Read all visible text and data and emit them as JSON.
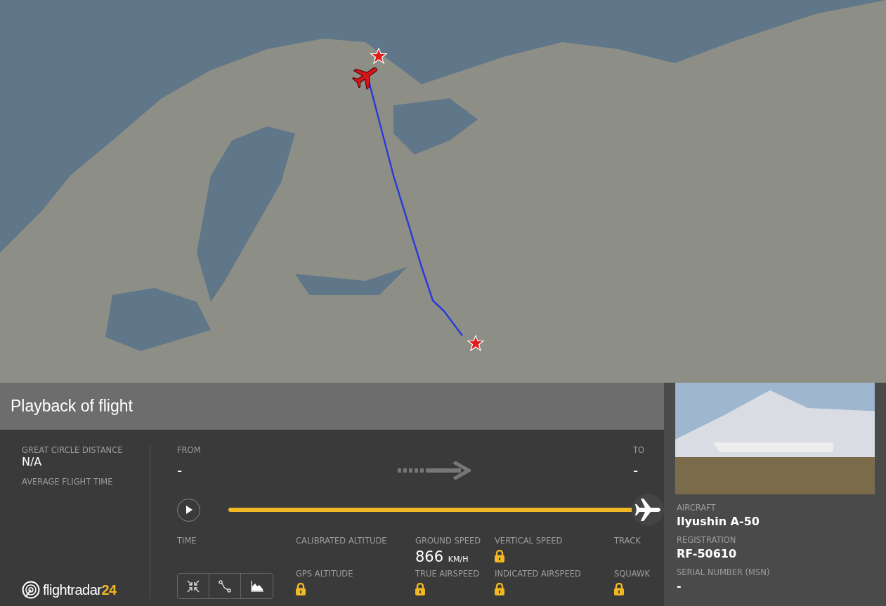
{
  "header": {
    "title": "Playback of flight"
  },
  "summary": [
    {
      "label": "GREAT CIRCLE DISTANCE",
      "value": "N/A"
    },
    {
      "label": "AVERAGE FLIGHT TIME"
    }
  ],
  "logo": {
    "text": "flightradar",
    "suffix": "24"
  },
  "route": {
    "from_label": "FROM",
    "from_value": "-",
    "to_label": "TO",
    "to_value": "-"
  },
  "playback": {
    "playing": false,
    "level": 1.0
  },
  "data_rows": [
    [
      {
        "label": "TIME",
        "kind": "empty"
      },
      {
        "label": "CALIBRATED ALTITUDE",
        "kind": "empty"
      },
      {
        "label": "GROUND SPEED",
        "kind": "value",
        "value": "866",
        "unit": "KM/H"
      },
      {
        "label": "VERTICAL SPEED",
        "kind": "locked"
      },
      {
        "label": "TRACK",
        "kind": "empty"
      }
    ],
    [
      {
        "label": "GPS ALTITUDE",
        "kind": "locked"
      },
      {
        "label": "TRUE AIRSPEED",
        "kind": "locked"
      },
      {
        "label": "INDICATED AIRSPEED",
        "kind": "locked"
      },
      {
        "label": "SQUAWK",
        "kind": "locked"
      }
    ]
  ],
  "view_buttons": [
    {
      "kind": "fit"
    },
    {
      "kind": "route"
    },
    {
      "kind": "graph"
    }
  ],
  "aircraft": [
    {
      "label": "AIRCRAFT",
      "value": "Ilyushin A-50"
    },
    {
      "label": "REGISTRATION",
      "value": "RF-50610"
    },
    {
      "label": "SERIAL NUMBER (MSN)",
      "value": "-"
    }
  ]
}
